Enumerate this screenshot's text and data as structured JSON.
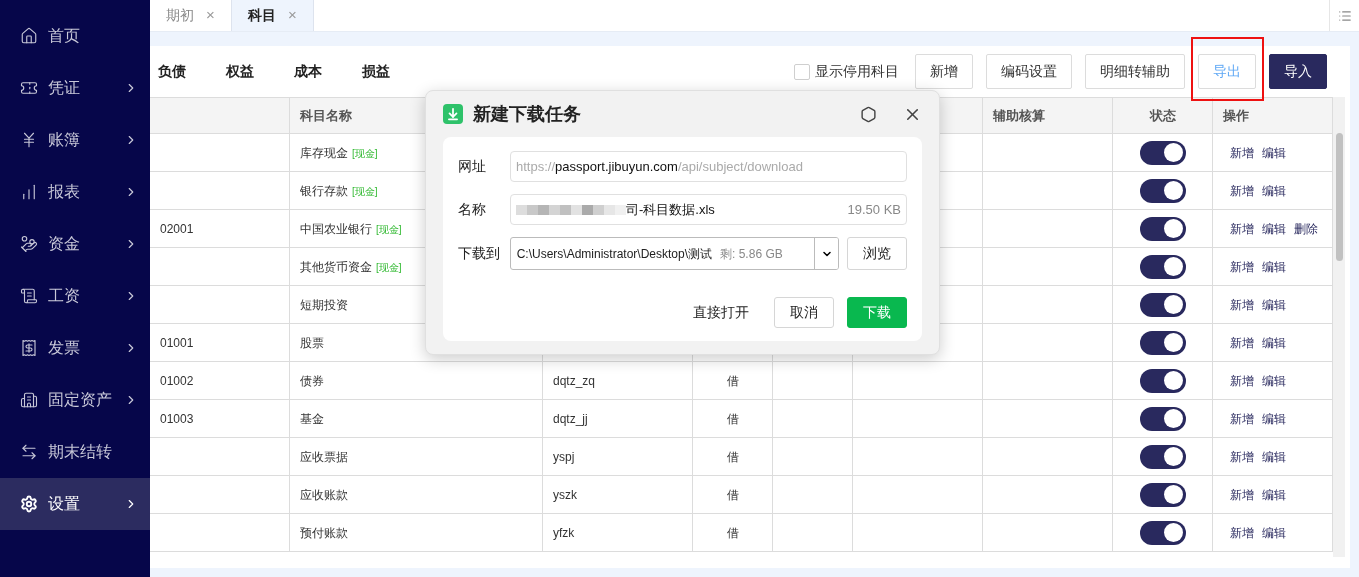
{
  "sidebar": {
    "items": [
      {
        "label": "首页",
        "expandable": false,
        "selected": false
      },
      {
        "label": "凭证",
        "expandable": true,
        "selected": false
      },
      {
        "label": "账簿",
        "expandable": true,
        "selected": false
      },
      {
        "label": "报表",
        "expandable": true,
        "selected": false
      },
      {
        "label": "资金",
        "expandable": true,
        "selected": false
      },
      {
        "label": "工资",
        "expandable": true,
        "selected": false
      },
      {
        "label": "发票",
        "expandable": true,
        "selected": false
      },
      {
        "label": "固定资产",
        "expandable": true,
        "selected": false
      },
      {
        "label": "期末结转",
        "expandable": false,
        "selected": false
      },
      {
        "label": "设置",
        "expandable": true,
        "selected": true
      }
    ]
  },
  "page_tabs": [
    {
      "label": "期初",
      "selected": false,
      "close": "×"
    },
    {
      "label": "科目",
      "selected": true,
      "close": "×"
    }
  ],
  "category_tabs": [
    {
      "label": "负债"
    },
    {
      "label": "权益"
    },
    {
      "label": "成本"
    },
    {
      "label": "损益"
    }
  ],
  "toolbar": {
    "show_disabled": {
      "label": "显示停用科目",
      "checked": false
    },
    "buttons": [
      {
        "label": "新增",
        "kind": "plain",
        "highlighted": false
      },
      {
        "label": "编码设置",
        "kind": "plain",
        "highlighted": false
      },
      {
        "label": "明细转辅助",
        "kind": "plain",
        "highlighted": false
      },
      {
        "label": "导出",
        "kind": "link",
        "highlighted": true
      },
      {
        "label": "导入",
        "kind": "primary",
        "highlighted": false
      }
    ]
  },
  "table": {
    "header": {
      "column_2": "科目名称",
      "column_7": "辅助核算",
      "column_8": "状态",
      "column_9": "操作"
    },
    "rows": [
      {
        "column_2": "库存现金",
        "tag": "[现金]",
        "enabled": true,
        "actions": [
          "新增",
          "编辑"
        ]
      },
      {
        "column_2": "银行存款",
        "tag": "[现金]",
        "enabled": true,
        "actions": [
          "新增",
          "编辑"
        ]
      },
      {
        "column_1": "02001",
        "column_2": "中国农业银行",
        "tag": "[现金]",
        "enabled": true,
        "actions": [
          "新增",
          "编辑",
          "删除"
        ]
      },
      {
        "column_2": "其他货币资金",
        "tag": "[现金]",
        "enabled": true,
        "actions": [
          "新增",
          "编辑"
        ]
      },
      {
        "column_2": "短期投资",
        "enabled": true,
        "actions": [
          "新增",
          "编辑"
        ]
      },
      {
        "column_1": "01001",
        "column_2": "股票",
        "enabled": true,
        "actions": [
          "新增",
          "编辑"
        ]
      },
      {
        "column_1": "01002",
        "column_2": "债券",
        "column_3": "dqtz_zq",
        "column_4": "借",
        "enabled": true,
        "actions": [
          "新增",
          "编辑"
        ]
      },
      {
        "column_1": "01003",
        "column_2": "基金",
        "column_3": "dqtz_jj",
        "column_4": "借",
        "enabled": true,
        "actions": [
          "新增",
          "编辑"
        ]
      },
      {
        "column_2": "应收票据",
        "column_3": "yspj",
        "column_4": "借",
        "enabled": true,
        "actions": [
          "新增",
          "编辑"
        ]
      },
      {
        "column_2": "应收账款",
        "column_3": "yszk",
        "column_4": "借",
        "enabled": true,
        "actions": [
          "新增",
          "编辑"
        ]
      },
      {
        "column_2": "预付账款",
        "column_3": "yfzk",
        "column_4": "借",
        "enabled": true,
        "actions": [
          "新增",
          "编辑"
        ]
      }
    ]
  },
  "dialog": {
    "title": "新建下载任务",
    "url": {
      "label": "网址",
      "parts": [
        {
          "text": "https://",
          "emphasis": false
        },
        {
          "text": "passport.jibuyun.com",
          "emphasis": true
        },
        {
          "text": "/api/subject/download",
          "emphasis": false
        }
      ]
    },
    "name": {
      "label": "名称",
      "value": "司-科目数据.xls",
      "size": "19.50 KB"
    },
    "save_to": {
      "label": "下载到",
      "path": "C:\\Users\\Administrator\\Desktop\\测试",
      "free": "剩: 5.86 GB",
      "browse": "浏览"
    },
    "buttons": [
      {
        "label": "直接打开",
        "kind": "text"
      },
      {
        "label": "取消",
        "kind": "plain"
      },
      {
        "label": "下载",
        "kind": "primary"
      }
    ]
  }
}
